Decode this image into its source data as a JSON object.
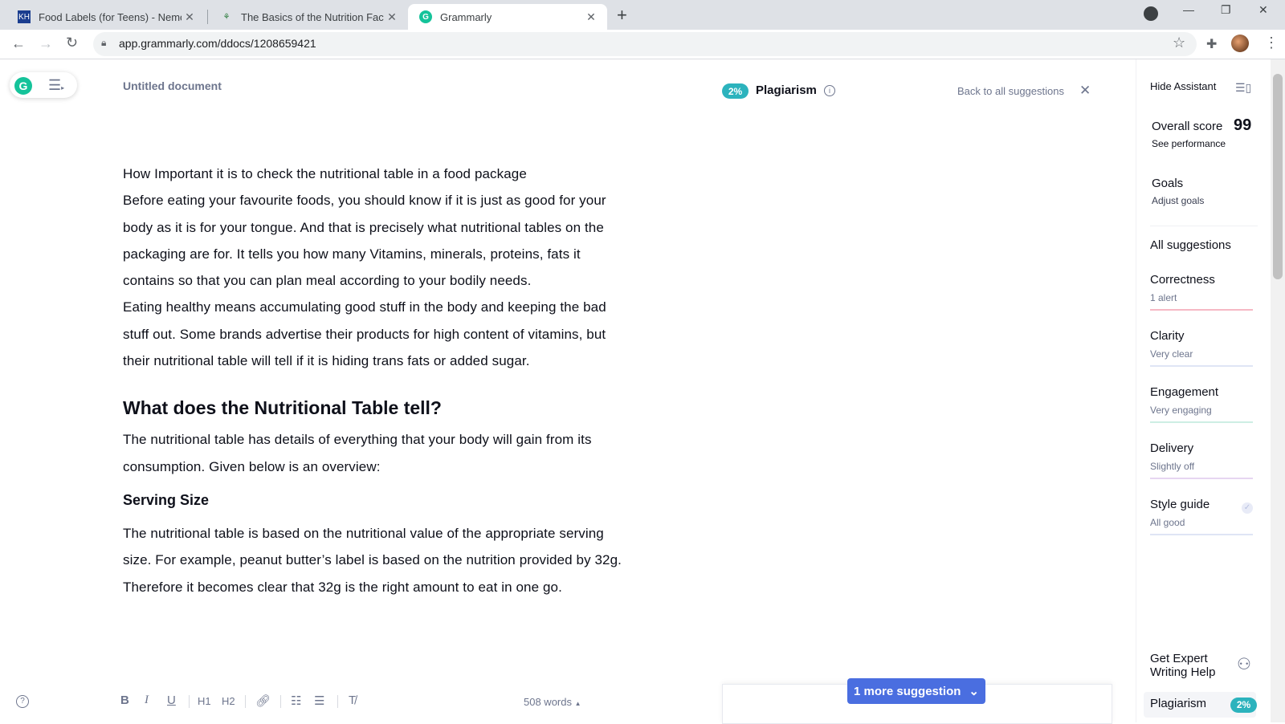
{
  "browser": {
    "tabs": [
      {
        "title": "Food Labels (for Teens) - Nemour",
        "favicon": "kidshealth-icon"
      },
      {
        "title": "The Basics of the Nutrition Facts L",
        "favicon": "fda-icon"
      },
      {
        "title": "Grammarly",
        "favicon": "grammarly-icon",
        "active": true
      }
    ],
    "url": "app.grammarly.com/ddocs/1208659421"
  },
  "editor": {
    "doc_title": "Untitled document",
    "plagiarism_badge": "2%",
    "plagiarism_label": "Plagiarism",
    "back_link": "Back to all suggestions",
    "paragraphs": [
      "How Important it is to check the nutritional table in a food package",
      "Before eating your favourite foods, you should know if it is just as good for your body as it is for your tongue. And that is precisely what nutritional tables on the packaging are for. It tells you how many Vitamins, minerals, proteins, fats it contains so that you can plan meal according to your bodily needs.",
      "Eating healthy means accumulating good stuff in the body and keeping the bad stuff out. Some brands advertise their products for high content of vitamins, but their nutritional table will tell if it is hiding trans fats or added sugar."
    ],
    "heading": "What does the Nutritional Table tell?",
    "paragraph_after_heading": "The nutritional table has details of everything that your body will gain from its consumption. Given below is an overview:",
    "subheading": "Serving Size",
    "paragraph_serving": "The nutritional table is based on the nutritional value of the appropriate serving size. For example, peanut butter’s label is based on the nutrition provided by 32g. Therefore it becomes clear that 32g is the right amount to eat in one go.",
    "toolbar": {
      "bold": "B",
      "italic": "I",
      "underline": "U",
      "h1": "H1",
      "h2": "H2",
      "word_count": "508 words"
    },
    "more_suggestion": "1 more suggestion"
  },
  "sidebar": {
    "hide_assistant": "Hide Assistant",
    "overall_score_label": "Overall score",
    "overall_score": "99",
    "see_performance": "See performance",
    "goals": "Goals",
    "adjust_goals": "Adjust goals",
    "all_suggestions": "All suggestions",
    "categories": [
      {
        "title": "Correctness",
        "status": "1 alert",
        "color": "#f6b8c4"
      },
      {
        "title": "Clarity",
        "status": "Very clear",
        "color": "#dfe5f5"
      },
      {
        "title": "Engagement",
        "status": "Very engaging",
        "color": "#cdeee4"
      },
      {
        "title": "Delivery",
        "status": "Slightly off",
        "color": "#e6d6f1"
      },
      {
        "title": "Style guide",
        "status": "All good",
        "color": "#dfe5f5"
      }
    ],
    "expert_help": "Get Expert Writing Help",
    "plagiarism_label": "Plagiarism",
    "plagiarism_badge": "2%"
  },
  "colors": {
    "grammarly_green": "#15c39a",
    "plagiarism_teal": "#2cb3bd",
    "suggestion_blue": "#4a6ee0"
  }
}
